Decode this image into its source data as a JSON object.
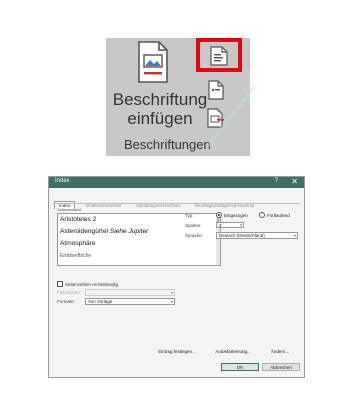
{
  "ribbon": {
    "insert_caption_label_line1": "Beschriftung",
    "insert_caption_label_line2": "einfügen",
    "group_label": "Beschriftungen"
  },
  "watermark": "tipps-tricks-kniffe.de/WinFAQ",
  "dialog": {
    "title": "Index",
    "help": "?",
    "close": "✕",
    "tabs": [
      "Index",
      "Inhaltsverzeichnis",
      "Abbildungsverzeichnis",
      "Rechtsgrundlagenverzeichnis"
    ],
    "preview_caption": "Seitenansicht",
    "preview_items": [
      {
        "text": "Aristoteles  2",
        "note": ""
      },
      {
        "text": "Asteroidengürtel  ",
        "note": "Siehe Jupiter"
      },
      {
        "text": "Atmosphäre",
        "note": ""
      },
      {
        "text": "   Erdoberfläche",
        "note": ""
      }
    ],
    "type_label": "Typ:",
    "type_options": [
      {
        "label": "Eingezogen",
        "selected": true
      },
      {
        "label": "Fortlaufend",
        "selected": false
      }
    ],
    "columns_label": "Spalten:",
    "columns_value": "2",
    "language_label": "Sprache:",
    "language_value": "Deutsch (Deutschland)",
    "right_align_label": "Seitenzahlen rechtsbündig",
    "tab_leader_label": "Füllzeichen:",
    "tab_leader_value": "......",
    "formats_label": "Formate:",
    "formats_value": "Von Vorlage",
    "buttons": {
      "mark_entry": "Eintrag festlegen...",
      "automark": "AutoMarkierung...",
      "modify": "Ändern...",
      "ok": "OK",
      "cancel": "Abbrechen"
    },
    "accent_color": "#3d6f64"
  }
}
